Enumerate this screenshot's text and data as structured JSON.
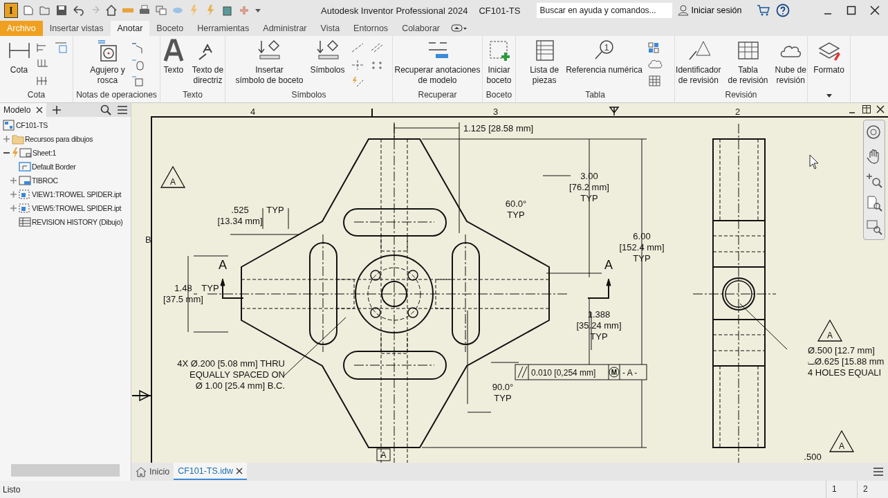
{
  "window": {
    "title": "Autodesk Inventor Professional 2024",
    "document": "CF101-TS"
  },
  "app_icon": {
    "label": "I"
  },
  "search": {
    "placeholder": "Buscar en ayuda y comandos..."
  },
  "account": {
    "label": "Iniciar sesión"
  },
  "ribbon_tabs": [
    {
      "label": "Archivo",
      "kind": "file",
      "selected": false
    },
    {
      "label": "Insertar vistas",
      "kind": "tab",
      "selected": false
    },
    {
      "label": "Anotar",
      "kind": "tab",
      "selected": true
    },
    {
      "label": "Boceto",
      "kind": "tab",
      "selected": false
    },
    {
      "label": "Herramientas",
      "kind": "tab",
      "selected": false
    },
    {
      "label": "Administrar",
      "kind": "tab",
      "selected": false
    },
    {
      "label": "Vista",
      "kind": "tab",
      "selected": false
    },
    {
      "label": "Entornos",
      "kind": "tab",
      "selected": false
    },
    {
      "label": "Colaborar",
      "kind": "tab",
      "selected": false
    }
  ],
  "ribbon_panels": [
    {
      "title": "Cota",
      "tools": [
        {
          "lines": [
            "Cota"
          ]
        }
      ]
    },
    {
      "title": "Notas de operaciones",
      "tools": [
        {
          "lines": [
            "Agujero y",
            "rosca"
          ]
        }
      ]
    },
    {
      "title": "Texto",
      "tools": [
        {
          "lines": [
            "Texto"
          ]
        },
        {
          "lines": [
            "Texto de",
            "directriz"
          ]
        }
      ]
    },
    {
      "title": "Símbolos",
      "tools": [
        {
          "lines": [
            "Insertar",
            "símbolo de boceto"
          ]
        },
        {
          "lines": [
            "Símbolos"
          ]
        }
      ]
    },
    {
      "title": "Recuperar",
      "tools": [
        {
          "lines": [
            "Recuperar anotaciones",
            "de modelo"
          ]
        }
      ]
    },
    {
      "title": "Boceto",
      "tools": [
        {
          "lines": [
            "Iniciar",
            "boceto"
          ]
        }
      ]
    },
    {
      "title": "Tabla",
      "tools": [
        {
          "lines": [
            "Lista de",
            "piezas"
          ]
        },
        {
          "lines": [
            "Referencia numérica"
          ],
          "icon_text": "1"
        }
      ]
    },
    {
      "title": "Revisión",
      "tools": [
        {
          "lines": [
            "Identificador",
            "de revisión"
          ]
        },
        {
          "lines": [
            "Tabla",
            "de revisión"
          ]
        },
        {
          "lines": [
            "Nube de",
            "revisión"
          ]
        }
      ]
    },
    {
      "tools": [
        {
          "lines": [
            "Formato"
          ]
        }
      ]
    }
  ],
  "browser": {
    "tab": "Modelo",
    "tree": [
      {
        "label": "CF101-TS",
        "kind": "document",
        "children": [
          {
            "label": "Recursos para dibujos",
            "kind": "folder",
            "expanded": false
          },
          {
            "label": "Sheet:1",
            "kind": "sheet",
            "expanded": true,
            "children": [
              {
                "label": "Default Border",
                "kind": "border"
              },
              {
                "label": "TIBROC",
                "kind": "titleblock",
                "expanded": false
              },
              {
                "label": "VIEW1:TROWEL SPIDER.ipt",
                "kind": "view",
                "expanded": false
              },
              {
                "label": "VIEW5:TROWEL SPIDER.ipt",
                "kind": "view",
                "expanded": false
              },
              {
                "label": "REVISION HISTORY (Dibujo)",
                "kind": "table"
              }
            ]
          }
        ]
      }
    ]
  },
  "drawing": {
    "zone_labels": [
      "4",
      "3",
      "2"
    ],
    "row_label": "B",
    "annotations": [
      {
        "lines": [
          "1.125 [28.58 mm]"
        ]
      },
      {
        "lines": [
          "3.00",
          "[76.2 mm]",
          "TYP"
        ]
      },
      {
        "lines": [
          "60.0°",
          "TYP"
        ]
      },
      {
        "lines": [
          ".525",
          "[13.34 mm]"
        ]
      },
      {
        "lines": [
          "TYP"
        ]
      },
      {
        "lines": [
          "6.00",
          "[152.4 mm]",
          "TYP"
        ]
      },
      {
        "lines": [
          "A"
        ]
      },
      {
        "lines": [
          "A"
        ]
      },
      {
        "lines": [
          "1.48",
          "[37.5 mm]"
        ]
      },
      {
        "lines": [
          "TYP"
        ]
      },
      {
        "lines": [
          "1.388",
          "[35.24 mm]",
          "TYP"
        ]
      },
      {
        "lines": [
          "4X Ø.200 [5.08 mm] THRU",
          "EQUALLY SPACED ON",
          "Ø 1.00 [25.4 mm] B.C."
        ]
      },
      {
        "lines": [
          "90.0°",
          "TYP"
        ]
      },
      {
        "lines": [
          "Ø.500 [12.7 mm]",
          "⌴Ø.625 [15.88 mm",
          "4 HOLES EQUALI"
        ]
      },
      {
        "lines": [
          ".500"
        ]
      }
    ],
    "revision_tags": [
      {
        "label": "A"
      },
      {
        "label": "A"
      },
      {
        "label": "A"
      }
    ],
    "datum_label": {
      "label": "A"
    },
    "control_frame": {
      "tolerance": "0.010 [0,254 mm]",
      "modifier": "M",
      "datum": "- A -"
    }
  },
  "document_tabs": [
    {
      "label": "Inicio",
      "kind": "home",
      "selected": false
    },
    {
      "label": "CF101-TS.idw",
      "kind": "document",
      "selected": true
    }
  ],
  "status_bar": {
    "text": "Listo",
    "sheets": [
      "1",
      "2"
    ]
  }
}
